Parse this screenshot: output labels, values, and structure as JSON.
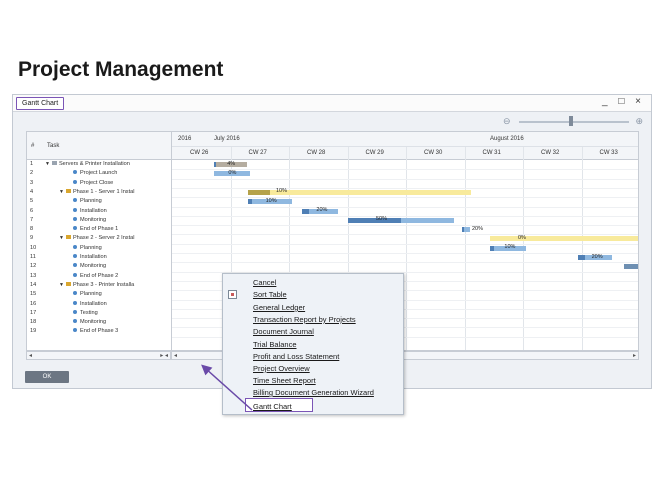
{
  "page_title": "Project Management",
  "window": {
    "title": "Gantt Chart",
    "controls": "_ □ ×"
  },
  "columns": {
    "num": "#",
    "task": "Task"
  },
  "timeline": {
    "year": "2016",
    "months": [
      {
        "label": "July 2016"
      },
      {
        "label": "August 2016"
      }
    ],
    "weeks": [
      "CW 26",
      "CW 27",
      "CW 28",
      "CW 29",
      "CW 30",
      "CW 31",
      "CW 32",
      "CW 33"
    ]
  },
  "rows": [
    {
      "num": "1",
      "title": "Servers & Printer Installation",
      "level": 0
    },
    {
      "num": "2",
      "title": "Project Launch",
      "level": 2
    },
    {
      "num": "3",
      "title": "Project Close",
      "level": 2
    },
    {
      "num": "4",
      "title": "Phase 1 - Server 1 Instal",
      "level": 1
    },
    {
      "num": "5",
      "title": "Planning",
      "level": 3
    },
    {
      "num": "6",
      "title": "Installation",
      "level": 3
    },
    {
      "num": "7",
      "title": "Monitoring",
      "level": 3
    },
    {
      "num": "8",
      "title": "End of Phase 1",
      "level": 3
    },
    {
      "num": "9",
      "title": "Phase 2 - Server 2 Instal",
      "level": 1
    },
    {
      "num": "10",
      "title": "Planning",
      "level": 3
    },
    {
      "num": "11",
      "title": "Installation",
      "level": 3
    },
    {
      "num": "12",
      "title": "Monitoring",
      "level": 3
    },
    {
      "num": "13",
      "title": "End of Phase 2",
      "level": 3
    },
    {
      "num": "14",
      "title": "Phase 3 - Printer Installa",
      "level": 1
    },
    {
      "num": "15",
      "title": "Planning",
      "level": 3
    },
    {
      "num": "16",
      "title": "Installation",
      "level": 3
    },
    {
      "num": "17",
      "title": "Testing",
      "level": 3
    },
    {
      "num": "18",
      "title": "Monitoring",
      "level": 3
    },
    {
      "num": "19",
      "title": "End of Phase 3",
      "level": 3
    }
  ],
  "bars": [
    {
      "row": 0,
      "label": "4%",
      "color": "#b5ada0"
    },
    {
      "row": 1,
      "label": "0%",
      "color": "#8fb8e0"
    },
    {
      "row": 3,
      "label": "10%",
      "color": "#f8ea9c"
    },
    {
      "row": 4,
      "label": "10%",
      "color": "#8fb8e0"
    },
    {
      "row": 5,
      "label": "20%",
      "color": "#8fb8e0"
    },
    {
      "row": 6,
      "label": "50%",
      "color": "#8fb8e0"
    },
    {
      "row": 7,
      "label": "20%",
      "color": "#8fb8e0"
    },
    {
      "row": 8,
      "label": "0%",
      "color": "#f8ea9c"
    },
    {
      "row": 9,
      "label": "10%",
      "color": "#8fb8e0"
    },
    {
      "row": 10,
      "label": "20%",
      "color": "#8fb8e0"
    },
    {
      "row": 11,
      "label": "",
      "color": "#6e8fb2"
    }
  ],
  "ok_label": "OK",
  "menu": {
    "items": [
      "Cancel",
      "Sort Table",
      "General Ledger",
      "Transaction Report by Projects",
      "Document Journal",
      "Trial Balance",
      "Profit and Loss Statement",
      "Project Overview",
      "Time Sheet Report",
      "Billing Document Generation Wizard"
    ],
    "selected": "Gantt Chart"
  }
}
